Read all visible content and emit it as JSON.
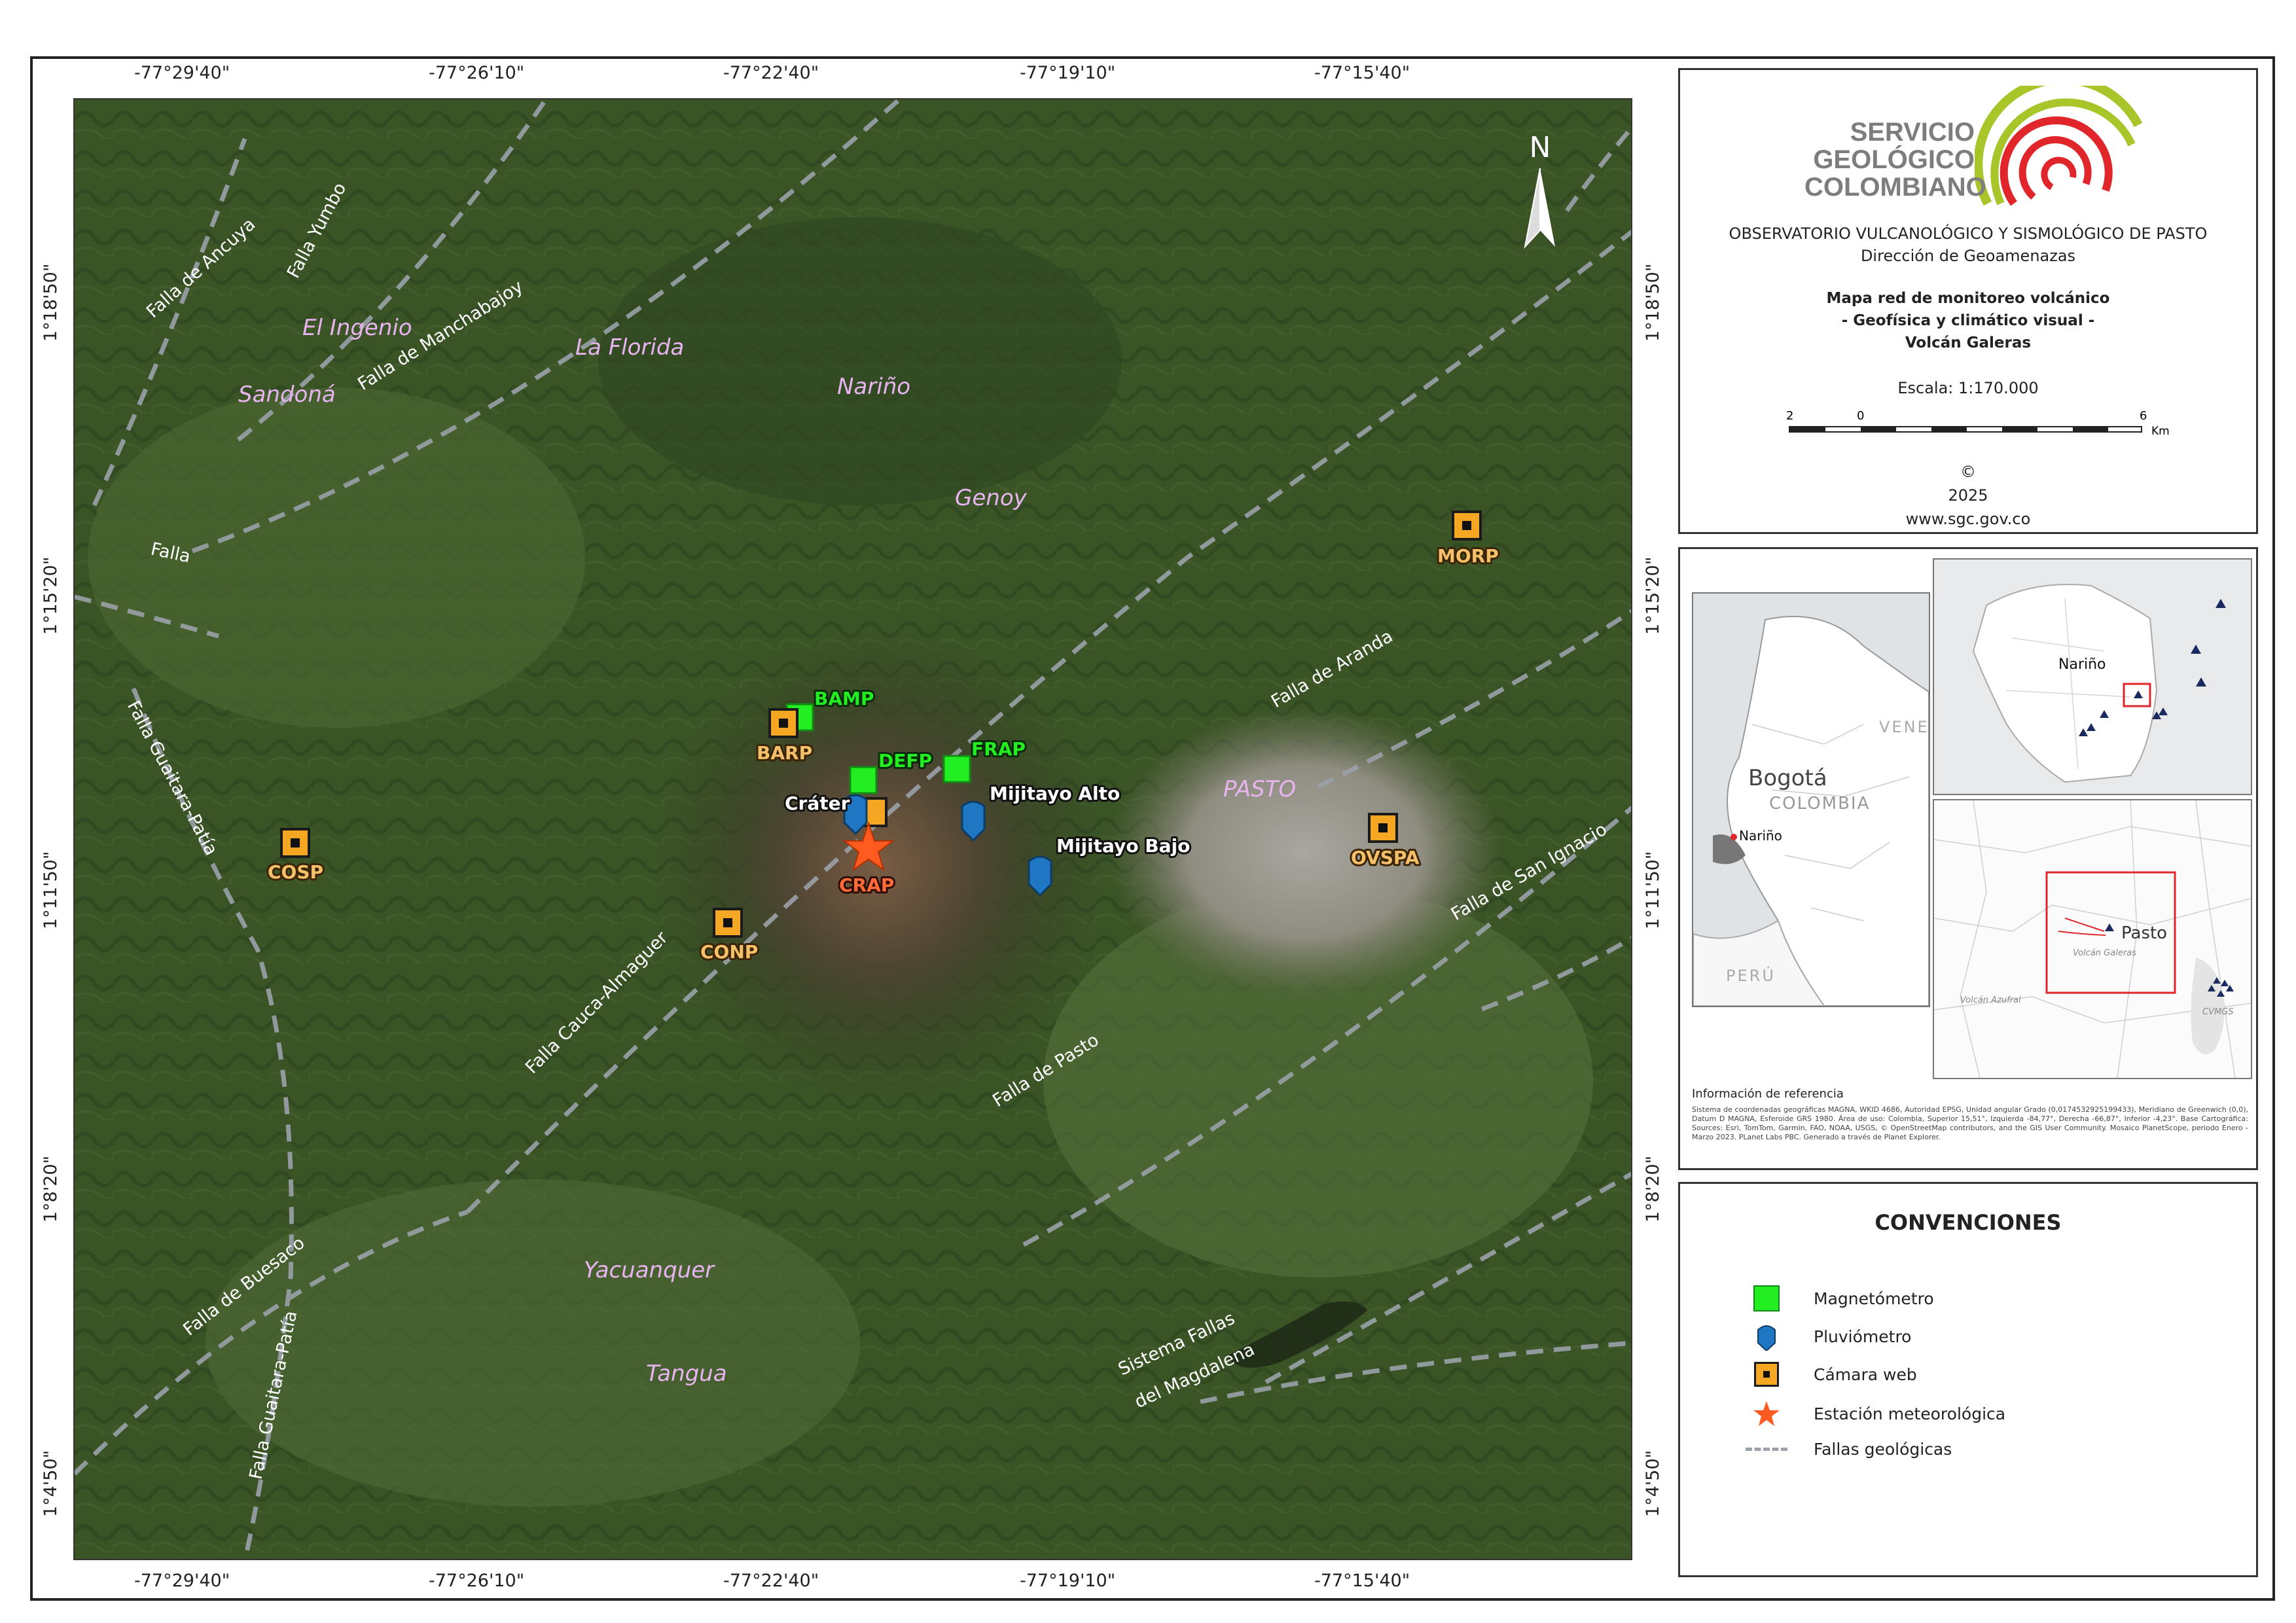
{
  "coords": {
    "top": [
      "-77°29'40\"",
      "-77°26'10\"",
      "-77°22'40\"",
      "-77°19'10\"",
      "-77°15'40\""
    ],
    "bottom": [
      "-77°29'40\"",
      "-77°26'10\"",
      "-77°22'40\"",
      "-77°19'10\"",
      "-77°15'40\""
    ],
    "left": [
      "1°18'50\"",
      "1°15'20\"",
      "1°11'50\"",
      "1°8'20\"",
      "1°4'50\""
    ],
    "right": [
      "1°18'50\"",
      "1°15'20\"",
      "1°11'50\"",
      "1°8'20\"",
      "1°4'50\""
    ]
  },
  "north_arrow": {
    "label": "N"
  },
  "places": [
    "El Ingenio",
    "La Florida",
    "Nariño",
    "Sandoná",
    "Genoy",
    "PASTO",
    "Yacuanquer",
    "Tangua"
  ],
  "faults": [
    "Falla de Ancuya",
    "Falla Yumbo",
    "Falla de Manchabajoy",
    "Falla",
    "Falla Guaitara-Patía",
    "Falla de Aranda",
    "Falla de San Ignacio",
    "Falla Cauca-Almaguer",
    "Falla de Pasto",
    "Falla de Buesaco",
    "Falla Guaitara-Patía",
    "Sistema Fallas",
    "del Magdalena"
  ],
  "stations": {
    "magnetometers": [
      "BAMP",
      "DEFP",
      "FRAP"
    ],
    "cameras": [
      "BARP",
      "COSP",
      "CONP",
      "MORP",
      "OVSPA"
    ],
    "pluviometers": [
      "Cráter",
      "Mijitayo Alto",
      "Mijitayo Bajo"
    ],
    "weather": [
      "CRAP"
    ]
  },
  "header": {
    "logo": [
      "SERVICIO",
      "GEOLÓGICO",
      "COLOMBIANO"
    ],
    "observatory": "OBSERVATORIO VULCANOLÓGICO Y SISMOLÓGICO DE PASTO",
    "direction": "Dirección de Geoamenazas",
    "title": [
      "Mapa red de monitoreo volcánico",
      "- Geofísica y climático visual -",
      "Volcán Galeras"
    ],
    "scale": "Escala: 1:170.000",
    "scalebar": {
      "labels": [
        "2",
        "0",
        "6"
      ],
      "unit": "Km"
    },
    "copyright": "©",
    "year": "2025",
    "website": "www.sgc.gov.co"
  },
  "inset": {
    "country": "COLOMBIA",
    "capital": "Bogotá",
    "region": "Nariño",
    "neighbors": [
      "VENEZ",
      "PERÚ"
    ],
    "region_map_label": "Nariño",
    "detail_city": "Pasto",
    "detail_volcano": "Volcán Galeras",
    "detail_other": [
      "Volcán Azufral",
      "CVMGS"
    ],
    "ref_title": "Información de referencia",
    "ref_text": "Sistema de coordenadas geográficas MAGNA, WKID 4686, Autoridad EPSG, Unidad angular Grado (0,0174532925199433), Meridiano de Greenwich (0,0), Datum D MAGNA, Esferoide GRS 1980. Área de uso: Colombia, Superior 15,51°, Izquierda -84,77°, Derecha -66,87°, Inferior -4,23°. Base Cartográfica: Sources: Esri, TomTom, Garmin, FAO, NOAA, USGS, © OpenStreetMap contributors, and the GIS User Community. Mosaico PlanetScope, periodo Enero - Marzo 2023. PLanet Labs PBC. Generado a través de Planet Explorer."
  },
  "legend": {
    "title": "CONVENCIONES",
    "items": [
      "Magnetómetro",
      "Pluviómetro",
      "Cámara web",
      "Estación meteorológica",
      "Fallas geológicas"
    ]
  },
  "colors": {
    "magnetometer": "#22ee22",
    "camera": "#f5a623",
    "pluviometer": "#1f77c4",
    "weather": "#ff5a1f",
    "fault": "#9aa1a8",
    "place": "#e7b4f0",
    "logo_text": "#7d7d7d",
    "logo_green": "#a8c62a",
    "logo_red": "#e0262b"
  }
}
